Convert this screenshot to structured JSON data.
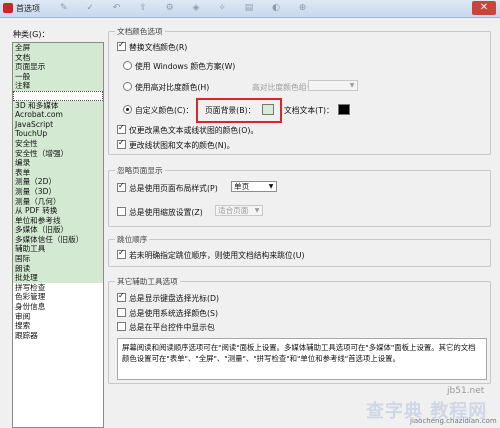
{
  "window": {
    "title": "首选项",
    "close_glyph": "✕",
    "toolbar_glyphs": "✎ ✓ ↶ ⇧ ⚙ ◈ ✧ ▤ ◐ ⊕"
  },
  "categories": {
    "label": "种类(G)：",
    "items": [
      "全屏",
      "文档",
      "页面显示",
      "一般",
      "注释",
      "",
      "3D 和多媒体",
      "Acrobat.com",
      "JavaScript",
      "TouchUp",
      "安全性",
      "安全性（增强）",
      "编录",
      "表单",
      "测量（2D）",
      "测量（3D）",
      "测量（几何）",
      "从 PDF 转换",
      "单位和参考线",
      "多媒体（旧版）",
      "多媒体信任（旧版）",
      "辅助工具",
      "国际",
      "朗读",
      "批处理",
      "拼写检查",
      "色彩管理",
      "身份信息",
      "审阅",
      "搜索",
      "跟踪器"
    ],
    "selected_index": 5
  },
  "doc_colors": {
    "legend": "文档颜色选项",
    "replace_label": "替换文档颜色(R)",
    "windows_scheme_label": "使用 Windows 颜色方案(W)",
    "high_contrast_label": "使用高对比度颜色(H)",
    "high_contrast_combo_label": "高对比度颜色组合(O)：",
    "custom_label": "自定义颜色(C)：",
    "page_bg_label": "页面背景(B)：",
    "page_bg_color": "#d7ecd6",
    "doc_text_label": "文档文本(T)：",
    "doc_text_color": "#000000",
    "only_black_label": "仅更改黑色文本或线状图的颜色(O)。",
    "change_line_label": "更改线状图和文本的颜色(N)。"
  },
  "page_display": {
    "legend": "忽略页面显示",
    "always_layout_label": "总是使用页面布局样式(P)",
    "layout_value": "单页",
    "always_zoom_label": "总是使用缩放设置(Z)",
    "zoom_value": "适合页面"
  },
  "reading_order": {
    "legend": "跳位顺序",
    "tab_order_label": "若未明确指定跳位顺序，则使用文档结构来跳位(U)"
  },
  "other": {
    "legend": "其它辅助工具选项",
    "keyboard_cursor_label": "总是显示键盘选择光标(D)",
    "system_color_label": "总是使用系统选择颜色(S)",
    "same_window_label": "总是在平台控件中显示包",
    "description": "屏幕阅读和阅读顺序选项可在\"阅读\"面板上设置。多媒体辅助工具选项可在\"多媒体\"面板上设置。其它的文档颜色设置可在\"表单\"、\"全屏\"、\"测量\"、\"拼写检查\"和\"单位和参考线\"首选项上设置。"
  },
  "watermark": {
    "site": "jb51.net",
    "brand": "查字典 教程网",
    "url": "jiaocheng.chazidian.com"
  }
}
